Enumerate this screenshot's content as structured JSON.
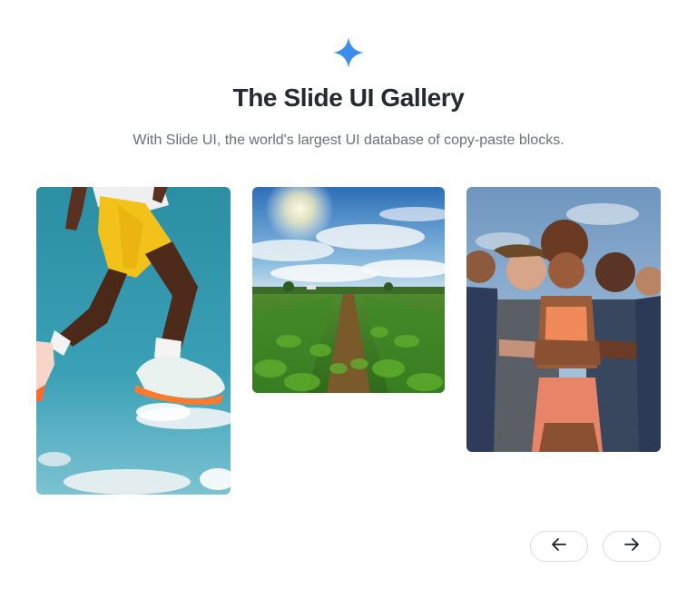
{
  "header": {
    "icon": "sparkle-star-icon",
    "accent_color": "#3b8ef0",
    "title": "The Slide UI Gallery",
    "subtitle": "With Slide UI, the world's largest UI database of copy-paste blocks."
  },
  "gallery": {
    "images": [
      {
        "name": "jumping-athlete-image",
        "description_icon": "athlete-legs-sky"
      },
      {
        "name": "crop-field-image",
        "description_icon": "farm-field-sky"
      },
      {
        "name": "athletes-group-image",
        "description_icon": "group-of-athletes"
      }
    ]
  },
  "navigation": {
    "prev_icon": "arrow-left-icon",
    "next_icon": "arrow-right-icon"
  }
}
